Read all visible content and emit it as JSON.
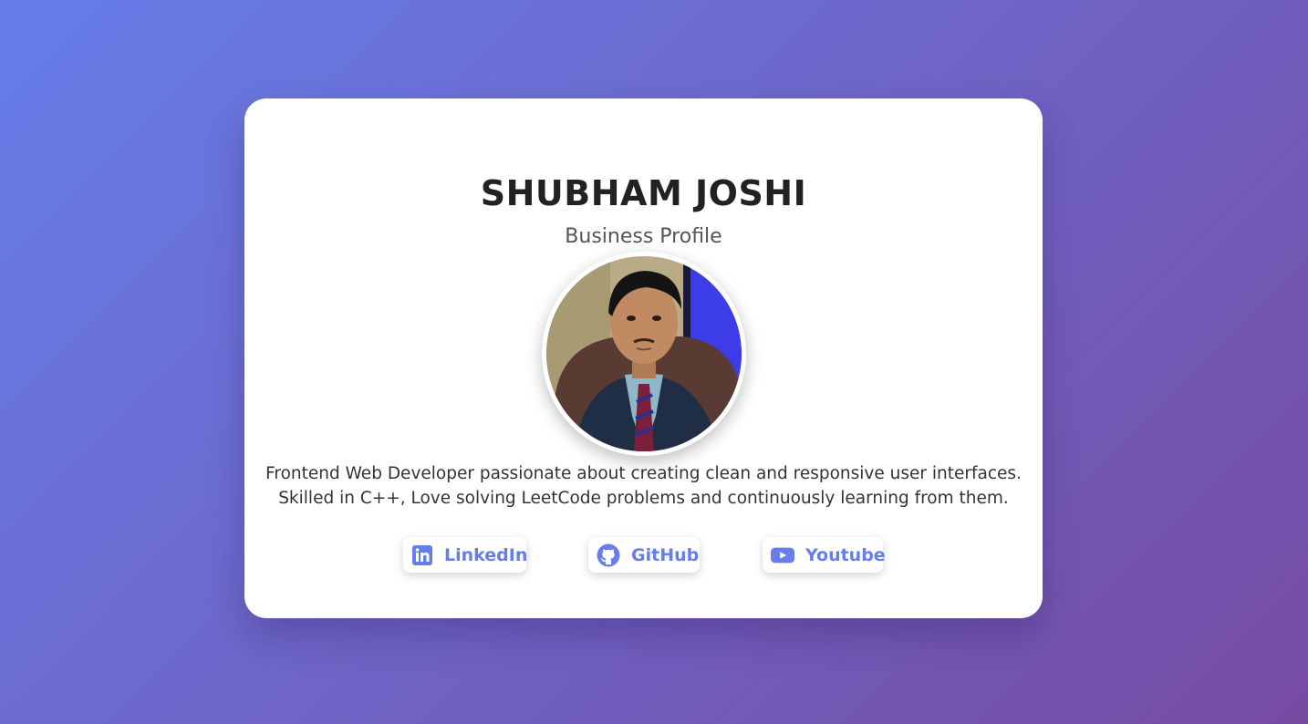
{
  "profile": {
    "name": "SHUBHAM JOSHI",
    "subtitle": "Business Profile",
    "bio_line1": "Frontend Web Developer passionate about creating clean and responsive user interfaces.",
    "bio_line2": "Skilled in C++, Love solving LeetCode problems and continuously learning from them."
  },
  "links": {
    "linkedin": {
      "label": "LinkedIn",
      "icon": "linkedin-icon"
    },
    "github": {
      "label": "GitHub",
      "icon": "github-icon"
    },
    "youtube": {
      "label": "Youtube",
      "icon": "youtube-icon"
    }
  },
  "colors": {
    "background_start": "#667eea",
    "background_end": "#764ba2",
    "accent": "#667eea",
    "card": "#ffffff"
  }
}
